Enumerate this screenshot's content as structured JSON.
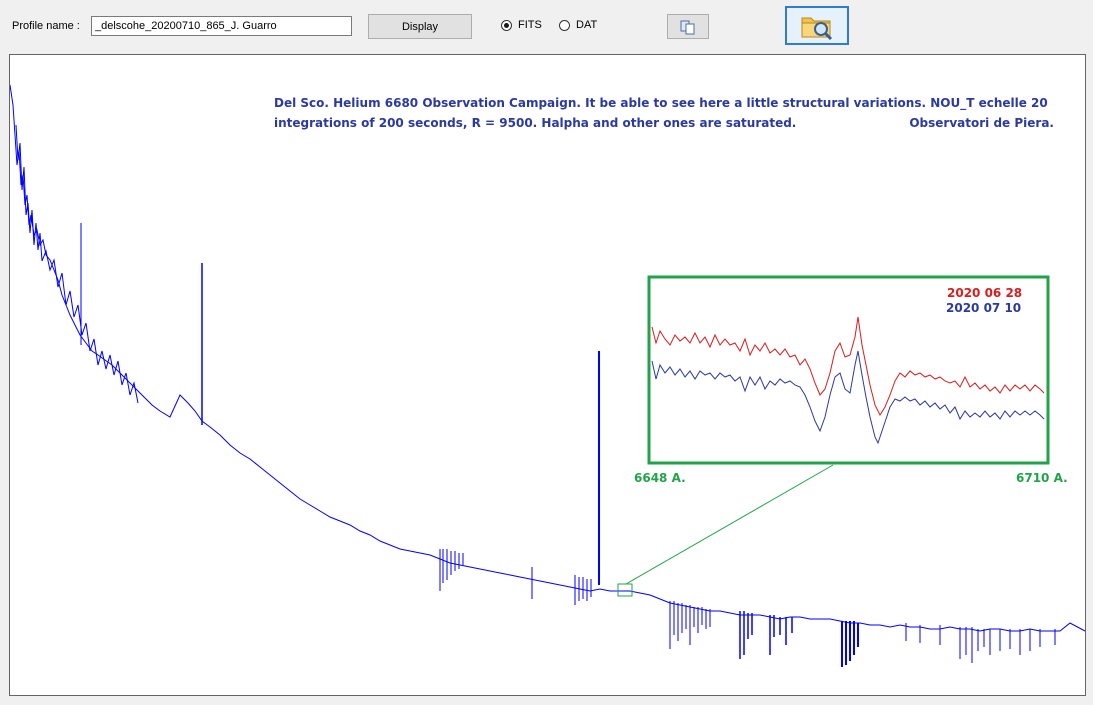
{
  "toolbar": {
    "profile_label": "Profile name :",
    "profile_value": "_delscohe_20200710_865_J. Guarro",
    "display_label": "Display",
    "radio_fits": "FITS",
    "radio_dat": "DAT",
    "selected_format": "FITS",
    "copy_icon": "copy-icon",
    "open_icon": "folder-search-icon"
  },
  "plot": {
    "annotation_line1": "Del Sco. Helium 6680 Observation Campaign.  It be able to see here a little structural variations. NOU_T echelle 20",
    "annotation_line2": "integrations of 200 seconds, R = 9500. Halpha and other ones are saturated.",
    "annotation_signature": "Observatori de Piera.",
    "inset": {
      "legend": [
        "2020 06 28",
        "2020 07 10"
      ],
      "legend_colors": [
        "#d81e1e",
        "#2b3a9f"
      ],
      "start_label": "6648 A.",
      "end_label": "6710 A."
    },
    "colors": {
      "spectrum": "#0000ff",
      "inset_border": "#22a34a"
    }
  }
}
